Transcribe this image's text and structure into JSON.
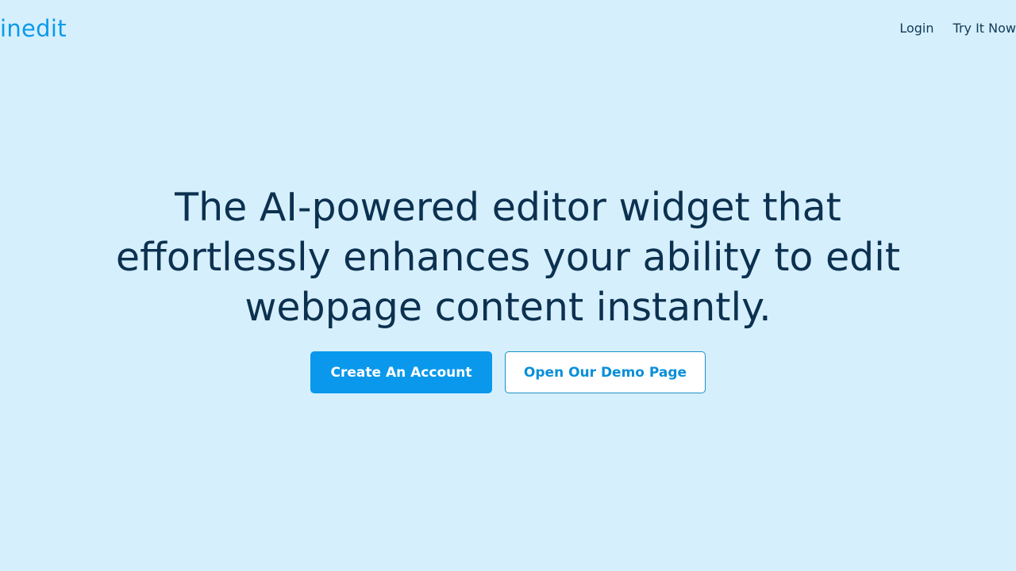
{
  "header": {
    "logo_text": "inedit",
    "nav": {
      "login_label": "Login",
      "try_label": "Try It Now"
    }
  },
  "hero": {
    "headline": "The AI-powered editor widget that effortlessly enhances your ability to edit webpage content instantly."
  },
  "actions": {
    "primary_label": "Create An Account",
    "secondary_label": "Open Our Demo Page"
  },
  "colors": {
    "background": "#d6effd",
    "brand": "#0a9aea",
    "headline": "#0c3150",
    "primary_button": "#0a98ec"
  }
}
